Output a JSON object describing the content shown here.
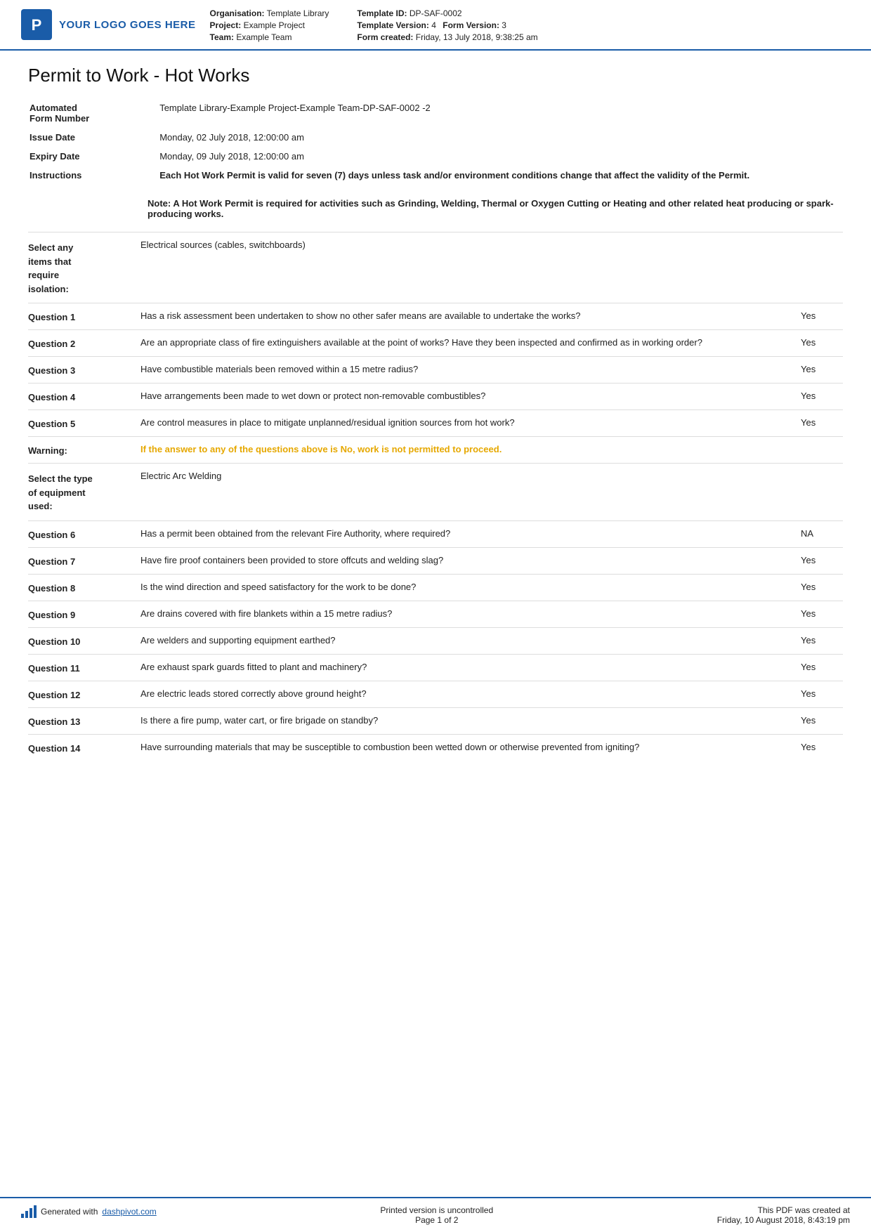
{
  "header": {
    "logo_text": "YOUR LOGO GOES HERE",
    "org_label": "Organisation:",
    "org_value": "Template Library",
    "project_label": "Project:",
    "project_value": "Example Project",
    "team_label": "Team:",
    "team_value": "Example Team",
    "template_id_label": "Template ID:",
    "template_id_value": "DP-SAF-0002",
    "template_version_label": "Template Version:",
    "template_version_value": "4",
    "form_version_label": "Form Version:",
    "form_version_value": "3",
    "form_created_label": "Form created:",
    "form_created_value": "Friday, 13 July 2018, 9:38:25 am"
  },
  "form": {
    "title": "Permit to Work - Hot Works",
    "automated_label": "Automated\nForm Number",
    "automated_value": "Template Library-Example Project-Example Team-DP-SAF-0002  -2",
    "issue_date_label": "Issue Date",
    "issue_date_value": "Monday, 02 July 2018, 12:00:00 am",
    "expiry_date_label": "Expiry Date",
    "expiry_date_value": "Monday, 09 July 2018, 12:00:00 am",
    "instructions_label": "Instructions",
    "instructions_value": "Each Hot Work Permit is valid for seven (7) days unless task and/or environment conditions change that affect the validity of the Permit.",
    "note": "Note: A Hot Work Permit is required for activities such as Grinding, Welding, Thermal or Oxygen Cutting or Heating and other related heat producing or spark-producing works.",
    "isolation_label": "Select any\nitems that\nrequire\nisolation:",
    "isolation_value": "Electrical sources (cables, switchboards)",
    "q1_label": "Question 1",
    "q1_text": "Has a risk assessment been undertaken to show no other safer means are available to undertake the works?",
    "q1_answer": "Yes",
    "q2_label": "Question 2",
    "q2_text": "Are an appropriate class of fire extinguishers available at the point of works? Have they been inspected and confirmed as in working order?",
    "q2_answer": "Yes",
    "q3_label": "Question 3",
    "q3_text": "Have combustible materials been removed within a 15 metre radius?",
    "q3_answer": "Yes",
    "q4_label": "Question 4",
    "q4_text": "Have arrangements been made to wet down or protect non-removable combustibles?",
    "q4_answer": "Yes",
    "q5_label": "Question 5",
    "q5_text": "Are control measures in place to mitigate unplanned/residual ignition sources from hot work?",
    "q5_answer": "Yes",
    "warning_label": "Warning:",
    "warning_text": "If the answer to any of the questions above is No, work is not permitted to proceed.",
    "equipment_label": "Select the type\nof equipment\nused:",
    "equipment_value": "Electric Arc Welding",
    "q6_label": "Question 6",
    "q6_text": "Has a permit been obtained from the relevant Fire Authority, where required?",
    "q6_answer": "NA",
    "q7_label": "Question 7",
    "q7_text": "Have fire proof containers been provided to store offcuts and welding slag?",
    "q7_answer": "Yes",
    "q8_label": "Question 8",
    "q8_text": "Is the wind direction and speed satisfactory for the work to be done?",
    "q8_answer": "Yes",
    "q9_label": "Question 9",
    "q9_text": "Are drains covered with fire blankets within a 15 metre radius?",
    "q9_answer": "Yes",
    "q10_label": "Question 10",
    "q10_text": "Are welders and supporting equipment earthed?",
    "q10_answer": "Yes",
    "q11_label": "Question 11",
    "q11_text": "Are exhaust spark guards fitted to plant and machinery?",
    "q11_answer": "Yes",
    "q12_label": "Question 12",
    "q12_text": "Are electric leads stored correctly above ground height?",
    "q12_answer": "Yes",
    "q13_label": "Question 13",
    "q13_text": "Is there a fire pump, water cart, or fire brigade on standby?",
    "q13_answer": "Yes",
    "q14_label": "Question 14",
    "q14_text": "Have surrounding materials that may be susceptible to combustion been wetted down or otherwise prevented from igniting?",
    "q14_answer": "Yes"
  },
  "footer": {
    "generated_text": "Generated with",
    "site_link": "dashpivot.com",
    "uncontrolled_text": "Printed version is uncontrolled",
    "page_text": "Page 1 of 2",
    "pdf_created_text": "This PDF was created at",
    "pdf_created_date": "Friday, 10 August 2018, 8:43:19 pm"
  }
}
